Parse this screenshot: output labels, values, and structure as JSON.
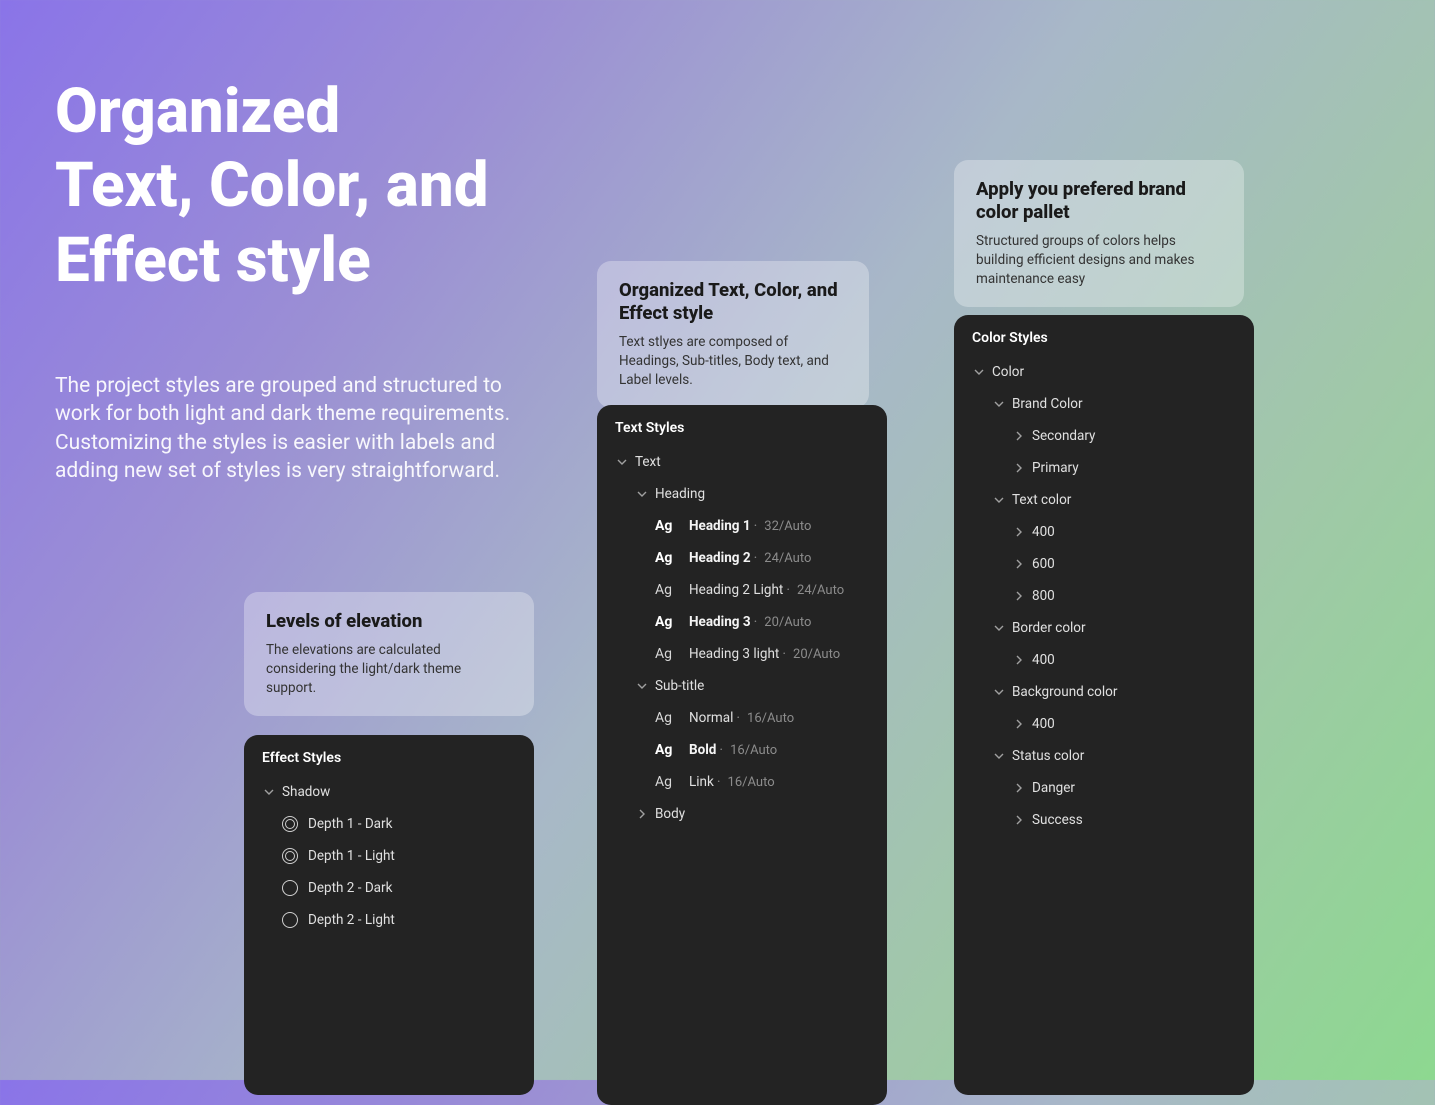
{
  "hero": {
    "title_line1": "Organized",
    "title_line2": "Text, Color, and",
    "title_line3": "Effect style",
    "description": "The project styles are grouped and structured to work for both light and dark theme requirements. Customizing the styles is easier with labels and adding new set of styles is very straightforward."
  },
  "cards": {
    "elevation": {
      "title": "Levels of elevation",
      "desc": "The elevations are calculated considering the light/dark theme support."
    },
    "text": {
      "title": "Organized Text, Color, and Effect style",
      "desc": "Text stlyes are composed of Headings, Sub-titles, Body text, and Label levels."
    },
    "color": {
      "title": "Apply you prefered brand color pallet",
      "desc": "Structured groups of colors helps building efficient designs and makes maintenance easy"
    }
  },
  "panels": {
    "effect": {
      "title": "Effect Styles",
      "root": "Shadow",
      "items": [
        "Depth 1 - Dark",
        "Depth 1 - Light",
        "Depth 2 - Dark",
        "Depth 2 - Light"
      ]
    },
    "text": {
      "title": "Text Styles",
      "root": "Text",
      "groups": {
        "heading": "Heading",
        "subtitle": "Sub-title",
        "body": "Body"
      },
      "headings": [
        {
          "name": "Heading 1",
          "meta": "32/Auto",
          "bold": true
        },
        {
          "name": "Heading 2",
          "meta": "24/Auto",
          "bold": true
        },
        {
          "name": "Heading 2 Light",
          "meta": "24/Auto",
          "bold": false
        },
        {
          "name": "Heading 3",
          "meta": "20/Auto",
          "bold": true
        },
        {
          "name": "Heading 3 light",
          "meta": "20/Auto",
          "bold": false
        }
      ],
      "subtitles": [
        {
          "name": "Normal",
          "meta": "16/Auto",
          "bold": false
        },
        {
          "name": "Bold",
          "meta": "16/Auto",
          "bold": true
        },
        {
          "name": "Link",
          "meta": "16/Auto",
          "bold": false
        }
      ]
    },
    "color": {
      "title": "Color Styles",
      "root": "Color",
      "groups": [
        {
          "name": "Brand Color",
          "items": [
            "Secondary",
            "Primary"
          ]
        },
        {
          "name": "Text color",
          "items": [
            "400",
            "600",
            "800"
          ]
        },
        {
          "name": "Border color",
          "items": [
            "400"
          ]
        },
        {
          "name": "Background color",
          "items": [
            "400"
          ]
        },
        {
          "name": "Status color",
          "items": [
            "Danger",
            "Success"
          ]
        }
      ]
    }
  },
  "ag_label": "Ag"
}
